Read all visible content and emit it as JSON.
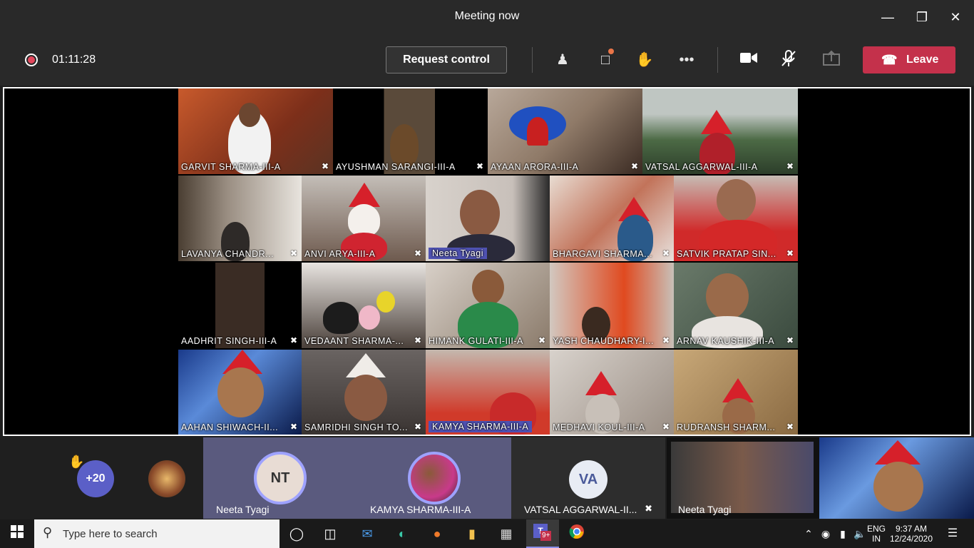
{
  "window": {
    "title": "Meeting now"
  },
  "toolbar": {
    "timer": "01:11:28",
    "request_control": "Request control",
    "leave": "Leave",
    "icons": [
      "participants-icon",
      "chat-icon",
      "raise-hand-icon",
      "more-icon",
      "camera-icon",
      "mic-muted-icon",
      "share-icon"
    ]
  },
  "grid": {
    "tiles": [
      {
        "name": "GARVIT  SHARMA-III-A"
      },
      {
        "name": "AYUSHMAN  SARANGI-III-A"
      },
      {
        "name": "AYAAN  ARORA-III-A"
      },
      {
        "name": "VATSAL  AGGARWAL-III-A"
      },
      {
        "name": "LAVANYA  CHANDR..."
      },
      {
        "name": "ANVI  ARYA-III-A"
      },
      {
        "name": "Neeta Tyagi"
      },
      {
        "name": "BHARGAVI  SHARMA..."
      },
      {
        "name": "SATVIK PRATAP SIN..."
      },
      {
        "name": "AADHRIT  SINGH-III-A"
      },
      {
        "name": "VEDAANT  SHARMA-..."
      },
      {
        "name": "HIMANK GULATI-III-A"
      },
      {
        "name": "YASH CHAUDHARY-I..."
      },
      {
        "name": "ARNAV  KAUSHIK-III-A"
      },
      {
        "name": "AAHAN  SHIWACH-II..."
      },
      {
        "name": "SAMRIDHI SINGH TO..."
      },
      {
        "name": "KAMYA  SHARMA-III-A"
      },
      {
        "name": "MEDHAVI  KOUL-III-A"
      },
      {
        "name": "RUDRANSH  SHARM..."
      }
    ]
  },
  "strip": {
    "overflow_count": "+20",
    "participants": [
      {
        "initials": "NT",
        "name": "Neeta Tyagi"
      },
      {
        "initials": "",
        "name": "KAMYA SHARMA-III-A"
      },
      {
        "initials": "VA",
        "name": "VATSAL AGGARWAL-II..."
      },
      {
        "initials": "",
        "name": "Neeta Tyagi"
      }
    ]
  },
  "taskbar": {
    "search_placeholder": "Type here to search",
    "teams_badge": "9+",
    "lang_1": "ENG",
    "lang_2": "IN",
    "time": "9:37 AM",
    "date": "12/24/2020"
  },
  "colors": {
    "leave": "#c4314b",
    "accent": "#4f52b2",
    "rec": "#e3475c"
  }
}
